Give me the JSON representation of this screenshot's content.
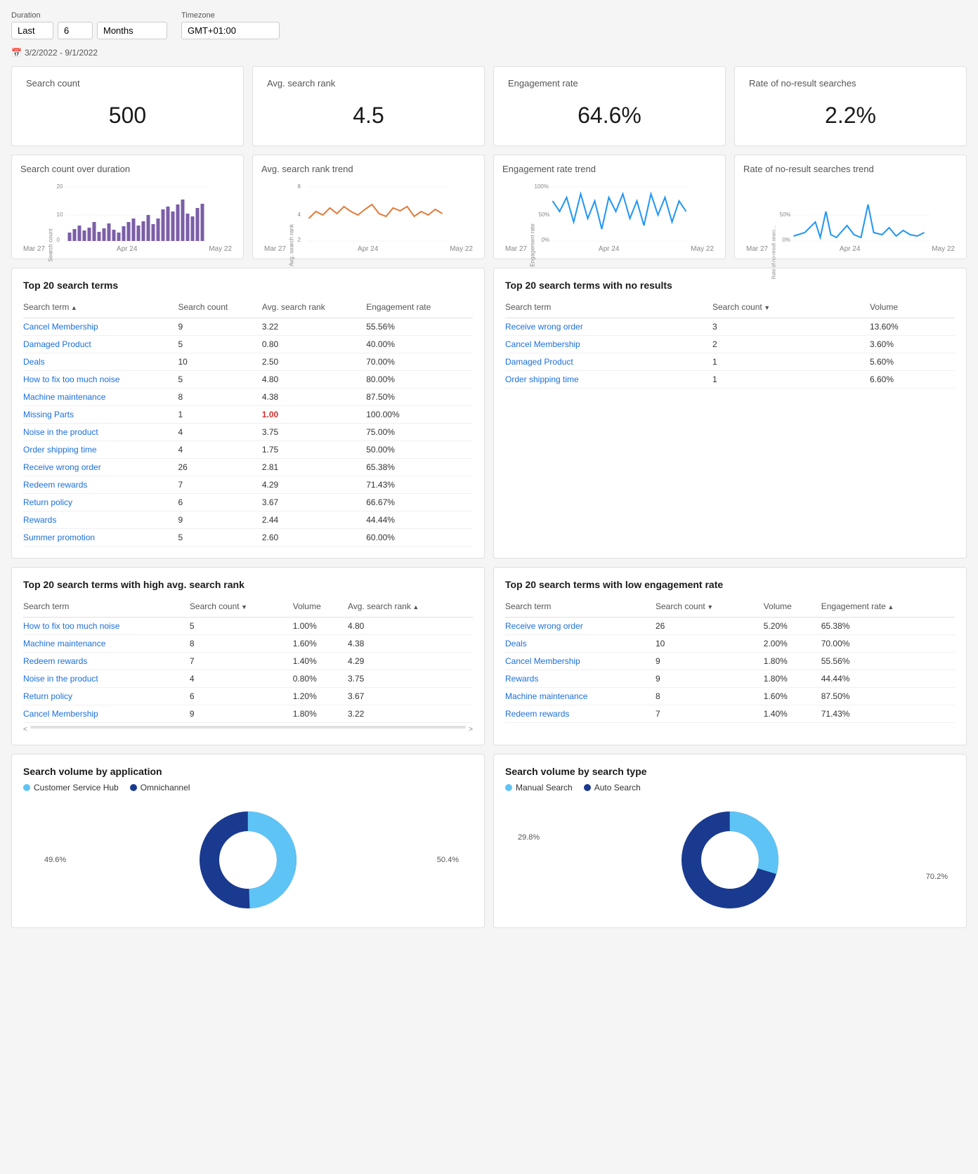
{
  "header": {
    "duration_label": "Duration",
    "timezone_label": "Timezone",
    "last_label": "Last",
    "duration_value": "6",
    "period_value": "Months",
    "timezone_value": "GMT+01:00",
    "date_range": "3/2/2022 - 9/1/2022",
    "calendar_icon": "📅"
  },
  "metric_cards": [
    {
      "title": "Search count",
      "value": "500"
    },
    {
      "title": "Avg. search rank",
      "value": "4.5"
    },
    {
      "title": "Engagement rate",
      "value": "64.6%"
    },
    {
      "title": "Rate of no-result searches",
      "value": "2.2%"
    }
  ],
  "chart_cards": [
    {
      "title": "Search count over duration",
      "x_labels": [
        "Mar 27",
        "Apr 24",
        "May 22"
      ],
      "type": "bar",
      "color": "#7b5ea7"
    },
    {
      "title": "Avg. search rank trend",
      "x_labels": [
        "Mar 27",
        "Apr 24",
        "May 22"
      ],
      "type": "line",
      "color": "#e07b3a"
    },
    {
      "title": "Engagement rate trend",
      "x_labels": [
        "Mar 27",
        "Apr 24",
        "May 22"
      ],
      "type": "line",
      "color": "#2196f3"
    },
    {
      "title": "Rate of no-result searches trend",
      "x_labels": [
        "Mar 27",
        "Apr 24",
        "May 22"
      ],
      "type": "line",
      "color": "#2196f3"
    }
  ],
  "top20_table": {
    "title": "Top 20 search terms",
    "columns": [
      "Search term",
      "Search count",
      "Avg. search rank",
      "Engagement rate"
    ],
    "rows": [
      [
        "Cancel Membership",
        "9",
        "3.22",
        "55.56%"
      ],
      [
        "Damaged Product",
        "5",
        "0.80",
        "40.00%"
      ],
      [
        "Deals",
        "10",
        "2.50",
        "70.00%"
      ],
      [
        "How to fix too much noise",
        "5",
        "4.80",
        "80.00%"
      ],
      [
        "Machine maintenance",
        "8",
        "4.38",
        "87.50%"
      ],
      [
        "Missing Parts",
        "1",
        "1.00",
        "100.00%"
      ],
      [
        "Noise in the product",
        "4",
        "3.75",
        "75.00%"
      ],
      [
        "Order shipping time",
        "4",
        "1.75",
        "50.00%"
      ],
      [
        "Receive wrong order",
        "26",
        "2.81",
        "65.38%"
      ],
      [
        "Redeem rewards",
        "7",
        "4.29",
        "71.43%"
      ],
      [
        "Return policy",
        "6",
        "3.67",
        "66.67%"
      ],
      [
        "Rewards",
        "9",
        "2.44",
        "44.44%"
      ],
      [
        "Summer promotion",
        "5",
        "2.60",
        "60.00%"
      ]
    ]
  },
  "no_results_table": {
    "title": "Top 20 search terms with no results",
    "columns": [
      "Search term",
      "Search count",
      "Volume"
    ],
    "rows": [
      [
        "Receive wrong order",
        "3",
        "13.60%"
      ],
      [
        "Cancel Membership",
        "2",
        "3.60%"
      ],
      [
        "Damaged Product",
        "1",
        "5.60%"
      ],
      [
        "Order shipping time",
        "1",
        "6.60%"
      ]
    ]
  },
  "high_rank_table": {
    "title": "Top 20 search terms with high avg. search rank",
    "columns": [
      "Search term",
      "Search count",
      "Volume",
      "Avg. search rank"
    ],
    "rows": [
      [
        "How to fix too much noise",
        "5",
        "1.00%",
        "4.80"
      ],
      [
        "Machine maintenance",
        "8",
        "1.60%",
        "4.38"
      ],
      [
        "Redeem rewards",
        "7",
        "1.40%",
        "4.29"
      ],
      [
        "Noise in the product",
        "4",
        "0.80%",
        "3.75"
      ],
      [
        "Return policy",
        "6",
        "1.20%",
        "3.67"
      ],
      [
        "Cancel Membership",
        "9",
        "1.80%",
        "3.22"
      ]
    ]
  },
  "low_engagement_table": {
    "title": "Top 20 search terms with low engagement rate",
    "columns": [
      "Search term",
      "Search count",
      "Volume",
      "Engagement rate"
    ],
    "rows": [
      [
        "Receive wrong order",
        "26",
        "5.20%",
        "65.38%"
      ],
      [
        "Deals",
        "10",
        "2.00%",
        "70.00%"
      ],
      [
        "Cancel Membership",
        "9",
        "1.80%",
        "55.56%"
      ],
      [
        "Rewards",
        "9",
        "1.80%",
        "44.44%"
      ],
      [
        "Machine maintenance",
        "8",
        "1.60%",
        "87.50%"
      ],
      [
        "Redeem rewards",
        "7",
        "1.40%",
        "71.43%"
      ]
    ]
  },
  "donut_app": {
    "title": "Search volume by application",
    "legend": [
      {
        "label": "Customer Service Hub",
        "color": "#5ec4f5"
      },
      {
        "label": "Omnichannel",
        "color": "#1a3a8f"
      }
    ],
    "segments": [
      {
        "label": "49.6%",
        "value": 49.6,
        "color": "#5ec4f5"
      },
      {
        "label": "50.4%",
        "value": 50.4,
        "color": "#1a3a8f"
      }
    ]
  },
  "donut_type": {
    "title": "Search volume by search type",
    "legend": [
      {
        "label": "Manual Search",
        "color": "#5ec4f5"
      },
      {
        "label": "Auto Search",
        "color": "#1a3a8f"
      }
    ],
    "segments": [
      {
        "label": "29.8%",
        "value": 29.8,
        "color": "#5ec4f5"
      },
      {
        "label": "70.2%",
        "value": 70.2,
        "color": "#1a3a8f"
      }
    ]
  }
}
